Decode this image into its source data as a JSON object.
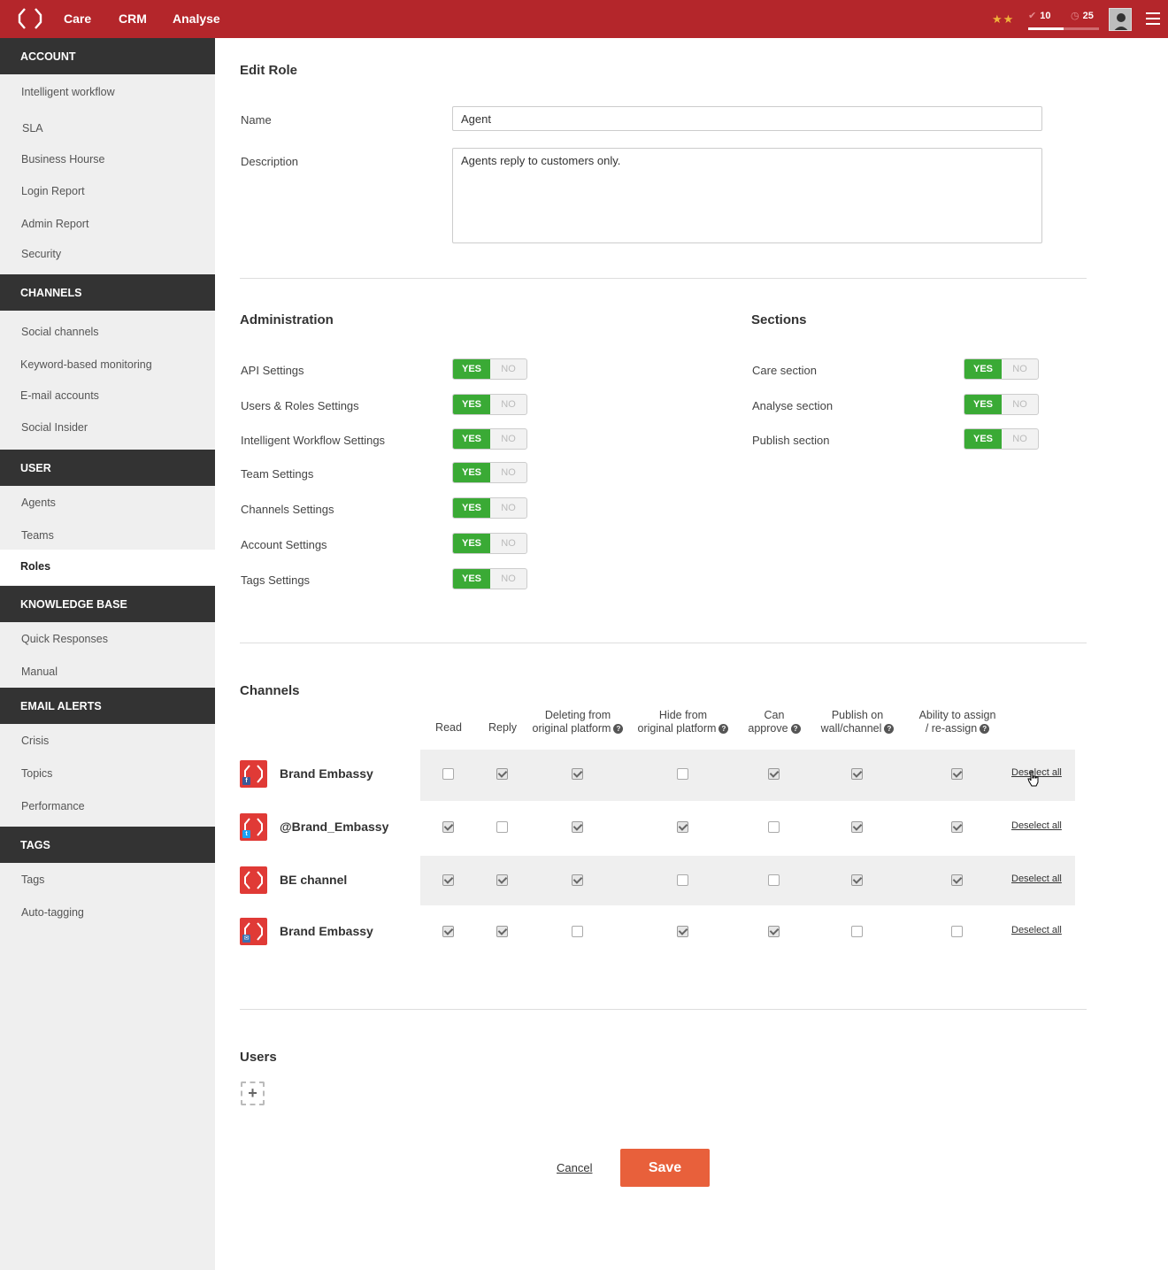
{
  "topbar": {
    "nav": [
      "Care",
      "CRM",
      "Analyse"
    ],
    "stars": "★★",
    "done_count": "10",
    "pending_count": "25",
    "progress": 0.5
  },
  "sidebar": {
    "sections": [
      {
        "title": "ACCOUNT",
        "items": [
          "Intelligent workflow",
          "SLA",
          "Business Hourse",
          "Login Report",
          "Admin Report",
          "Security"
        ]
      },
      {
        "title": "CHANNELS",
        "items": [
          "Social channels",
          "Keyword-based monitoring",
          "E-mail accounts",
          "Social Insider"
        ]
      },
      {
        "title": "USER",
        "items": [
          "Agents",
          "Teams",
          "Roles"
        ]
      },
      {
        "title": "KNOWLEDGE BASE",
        "items": [
          "Quick Responses",
          "Manual"
        ]
      },
      {
        "title": "EMAIL ALERTS",
        "items": [
          "Crisis",
          "Topics",
          "Performance"
        ]
      },
      {
        "title": "TAGS",
        "items": [
          "Tags",
          "Auto-tagging"
        ]
      }
    ],
    "active_item": "Roles"
  },
  "form": {
    "title": "Edit Role",
    "name_label": "Name",
    "name_value": "Agent",
    "description_label": "Description",
    "description_value": "Agents reply to customers only."
  },
  "administration": {
    "title": "Administration",
    "yes_label": "YES",
    "no_label": "NO",
    "items": [
      {
        "label": "API Settings",
        "value": "YES"
      },
      {
        "label": "Users & Roles Settings",
        "value": "YES"
      },
      {
        "label": "Intelligent Workflow Settings",
        "value": "YES"
      },
      {
        "label": "Team Settings",
        "value": "YES"
      },
      {
        "label": "Channels Settings",
        "value": "YES"
      },
      {
        "label": "Account Settings",
        "value": "YES"
      },
      {
        "label": "Tags Settings",
        "value": "YES"
      }
    ]
  },
  "sections": {
    "title": "Sections",
    "items": [
      {
        "label": "Care section",
        "value": "YES"
      },
      {
        "label": "Analyse section",
        "value": "YES"
      },
      {
        "label": "Publish section",
        "value": "YES"
      }
    ]
  },
  "channels": {
    "title": "Channels",
    "columns": [
      {
        "line1": "Read",
        "line2": ""
      },
      {
        "line1": "Reply",
        "line2": ""
      },
      {
        "line1": "Deleting from",
        "line2": "original platform"
      },
      {
        "line1": "Hide from",
        "line2": "original platform"
      },
      {
        "line1": "Can",
        "line2": "approve"
      },
      {
        "line1": "Publish on",
        "line2": "wall/channel"
      },
      {
        "line1": "Ability to assign",
        "line2": "/ re-assign"
      }
    ],
    "deselect_label": "Deselect all",
    "rows": [
      {
        "name": "Brand Embassy",
        "network": "f",
        "network_color": "#3b5998",
        "checks": [
          false,
          true,
          true,
          false,
          true,
          true,
          true
        ]
      },
      {
        "name": "@Brand_Embassy",
        "network": "t",
        "network_color": "#1da1f2",
        "checks": [
          true,
          false,
          true,
          true,
          false,
          true,
          true
        ]
      },
      {
        "name": "BE channel",
        "network": "",
        "network_color": "",
        "checks": [
          true,
          true,
          true,
          false,
          false,
          true,
          true
        ]
      },
      {
        "name": "Brand Embassy",
        "network": "✉",
        "network_color": "#3c6fb0",
        "checks": [
          true,
          true,
          false,
          true,
          true,
          false,
          false
        ]
      }
    ]
  },
  "users": {
    "title": "Users",
    "add_symbol": "+"
  },
  "actions": {
    "cancel": "Cancel",
    "save": "Save"
  },
  "colors": {
    "brand": "#b4262b",
    "yes": "#3aaa35",
    "save": "#e8603b"
  }
}
